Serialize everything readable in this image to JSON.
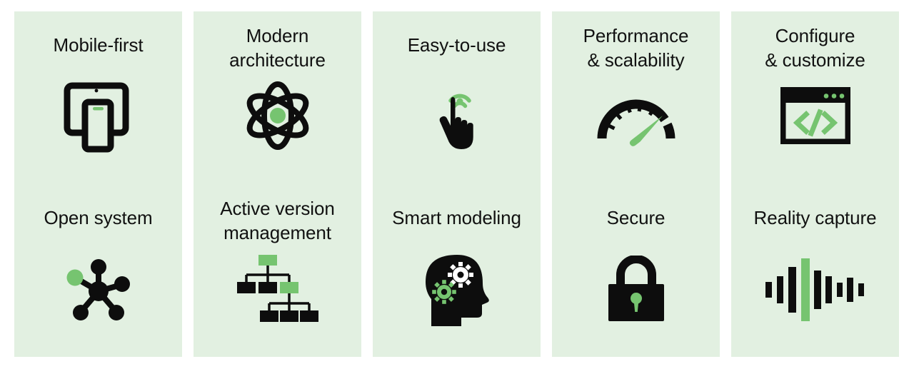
{
  "page": {
    "background_color": "#ffffff",
    "card_background_color": "#e2f0e1",
    "accent_color": "#76c470",
    "dark_color": "#0d0d0d",
    "text_color": "#111111",
    "columns": 5,
    "rows": 2
  },
  "cards": [
    {
      "title": "Mobile-first",
      "icon": "tablet-phone-icon",
      "lines": 1
    },
    {
      "title": "Modern\narchitecture",
      "icon": "atom-icon",
      "lines": 2
    },
    {
      "title": "Easy-to-use",
      "icon": "tap-hand-icon",
      "lines": 1
    },
    {
      "title": "Performance\n& scalability",
      "icon": "gauge-icon",
      "lines": 2
    },
    {
      "title": "Configure\n& customize",
      "icon": "code-window-icon",
      "lines": 2
    },
    {
      "title": "Open system",
      "icon": "network-hub-icon",
      "lines": 1
    },
    {
      "title": "Active version\nmanagement",
      "icon": "hierarchy-tree-icon",
      "lines": 2
    },
    {
      "title": "Smart modeling",
      "icon": "head-gears-icon",
      "lines": 1
    },
    {
      "title": "Secure",
      "icon": "padlock-icon",
      "lines": 1
    },
    {
      "title": "Reality capture",
      "icon": "waveform-icon",
      "lines": 1
    }
  ]
}
